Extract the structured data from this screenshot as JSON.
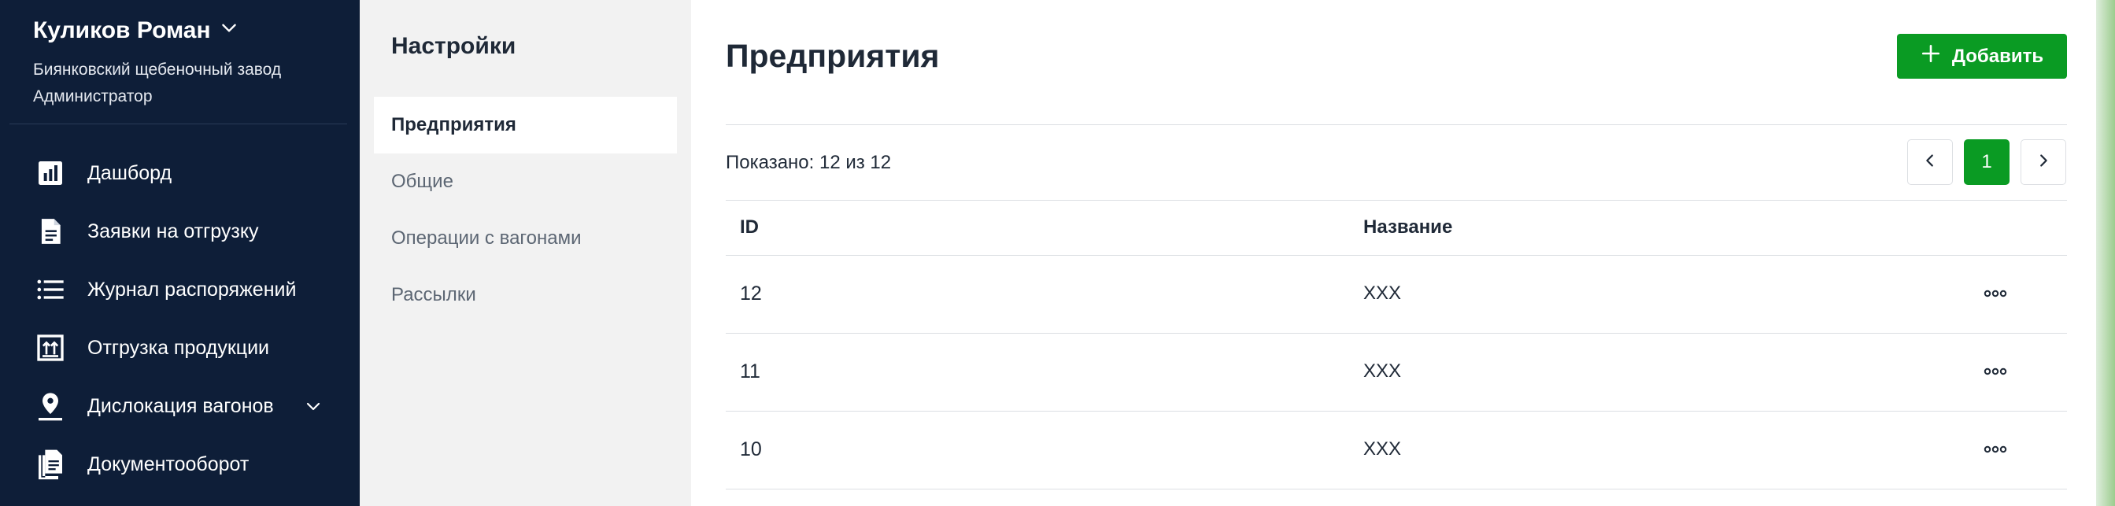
{
  "user": {
    "name": "Куликов Роман",
    "organization": "Биянковский щебеночный завод",
    "role": "Администратор"
  },
  "nav": {
    "items": [
      {
        "label": "Дашборд",
        "icon": "bar-chart-icon"
      },
      {
        "label": "Заявки на отгрузку",
        "icon": "document-icon"
      },
      {
        "label": "Журнал распоряжений",
        "icon": "list-icon"
      },
      {
        "label": "Отгрузка продукции",
        "icon": "upload-box-icon"
      },
      {
        "label": "Дислокация вагонов",
        "icon": "map-pin-icon",
        "has_chevron": true
      },
      {
        "label": "Документооборот",
        "icon": "documents-icon"
      }
    ]
  },
  "settings": {
    "title": "Настройки",
    "items": [
      {
        "label": "Предприятия",
        "active": true
      },
      {
        "label": "Общие"
      },
      {
        "label": "Операции с вагонами"
      },
      {
        "label": "Рассылки"
      }
    ]
  },
  "main": {
    "title": "Предприятия",
    "add_label": "Добавить",
    "shown_text": "Показано: 12 из 12",
    "pagination": {
      "current_page": "1"
    },
    "columns": {
      "id": "ID",
      "name": "Название"
    },
    "rows": [
      {
        "id": "12",
        "name": "XXX"
      },
      {
        "id": "11",
        "name": "XXX"
      },
      {
        "id": "10",
        "name": "XXX"
      }
    ]
  },
  "colors": {
    "sidebar": "#0e1e38",
    "accent": "#0a9b23",
    "settings_bg": "#f2f2f2"
  }
}
